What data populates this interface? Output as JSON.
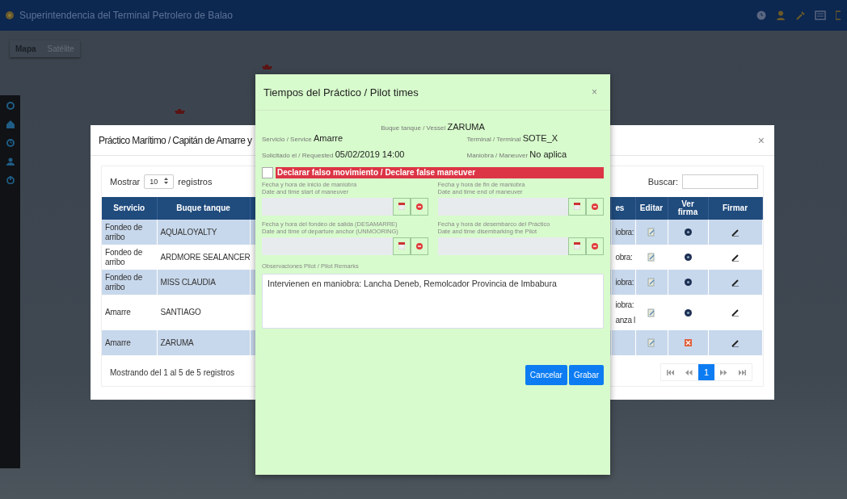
{
  "app": {
    "title": "Superintendencia del Terminal Petrolero de Balao"
  },
  "map_types": [
    {
      "label": "Mapa",
      "selected": true
    },
    {
      "label": "Satélite",
      "selected": false
    }
  ],
  "records_dialog": {
    "title": "Práctico Marítimo / Capitán de Amarre y",
    "close": "×",
    "length_before": "Mostrar",
    "page_length": "10",
    "length_after": "registros",
    "search_label": "Buscar:",
    "columns": [
      "Servicio",
      "Buque tanque",
      "es",
      "Editar",
      "Ver firma",
      "Firmar"
    ],
    "rows": [
      {
        "service": "Fondeo de arribo",
        "vessel": "AQUALOYALTY",
        "column_3": "iobra:",
        "signed": true
      },
      {
        "service": "Fondeo de arribo",
        "vessel": "ARDMORE SEALANCER",
        "column_3": "obra:",
        "signed": true
      },
      {
        "service": "Fondeo de arribo",
        "vessel": "MISS CLAUDIA",
        "column_3": "iobra:",
        "signed": true
      },
      {
        "service": "Amarre",
        "vessel": "SANTIAGO",
        "column_3": "iobra:\nanza l",
        "signed": true
      },
      {
        "service": "Amarre",
        "vessel": "ZARUMA",
        "signed": false
      }
    ],
    "info": "Mostrando del 1 al 5 de 5 registros",
    "pages": [
      {
        "label": "1",
        "selected": true
      }
    ]
  },
  "pilot_dialog": {
    "title": "Tiempos del Práctico / Pilot times",
    "close": "×",
    "vessel": {
      "label": "Buque tanque / Vessel",
      "value": "ZARUMA"
    },
    "details": [
      {
        "label": "Servicio / Service",
        "value": "Amarre"
      },
      {
        "label": "Terminal / Terminal",
        "value": "SOTE_X"
      },
      {
        "label": "Solicitado el / Requested",
        "value": "05/02/2019 14:00"
      },
      {
        "label": "Maniobra / Maneuver",
        "value": "No aplica"
      }
    ],
    "false_maneuver": {
      "label": "Declarar falso movimiento / Declare false maneuver",
      "checked": false
    },
    "time_fields": [
      {
        "label_es": "Fecha y hora de inicio de maniobra",
        "label_en": "Date and time start of maneuver"
      },
      {
        "label_es": "Fecha y hora de fin de maniobra",
        "label_en": "Date and time end of maneuver"
      },
      {
        "label_es": "Fecha y hora del fondeo de salida (DESAMARRE)",
        "label_en": "Date and time of departure anchor (UNMOORING)"
      },
      {
        "label_es": "Fecha y hora de desembarco del Práctico",
        "label_en": "Date and time disembarking the Pilot"
      }
    ],
    "remarks": {
      "label": "Observaciones Pilot / Pilot Remarks",
      "value": "Intervienen en maniobra: Lancha Deneb, Remolcador Provincia de Imbabura"
    },
    "buttons": [
      {
        "label": "Cancelar"
      },
      {
        "label": "Grabar"
      }
    ]
  }
}
